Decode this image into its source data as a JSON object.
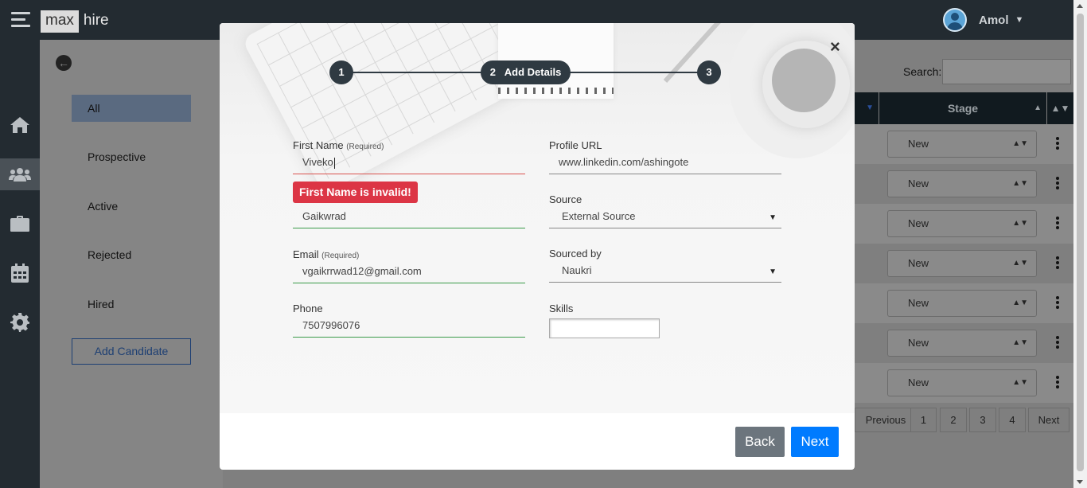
{
  "topbar": {
    "logo_left": "max",
    "logo_right": "hire",
    "username": "Amol"
  },
  "rail": [
    "home-icon",
    "users-icon",
    "briefcase-icon",
    "calendar-icon",
    "gear-icon"
  ],
  "filters": {
    "items": [
      "All",
      "Prospective",
      "Active",
      "Rejected",
      "Hired"
    ],
    "add_candidate": "Add Candidate"
  },
  "table": {
    "search_label": "Search:",
    "stage_header": "Stage",
    "stage_values": [
      "New",
      "New",
      "New",
      "New",
      "New",
      "New",
      "New"
    ],
    "pagination": [
      "Previous",
      "1",
      "2",
      "3",
      "4",
      "Next"
    ]
  },
  "modal": {
    "close": "×",
    "steps": [
      {
        "number": "1",
        "label": ""
      },
      {
        "number": "2",
        "label": "Add Details"
      },
      {
        "number": "3",
        "label": ""
      }
    ],
    "left_fields": {
      "first_name": {
        "label": "First Name",
        "required": "(Required)",
        "value": "Viveko"
      },
      "last_name": {
        "value": "Gaikwrad"
      },
      "email": {
        "label": "Email",
        "required": "(Required)",
        "value": "vgaikrrwad12@gmail.com"
      },
      "phone": {
        "label": "Phone",
        "value": "7507996076"
      }
    },
    "error": "First Name is invalid!",
    "right_fields": {
      "profile_url": {
        "label": "Profile URL",
        "value": "www.linkedin.com/ashingote"
      },
      "source": {
        "label": "Source",
        "value": "External Source"
      },
      "sourced_by": {
        "label": "Sourced by",
        "value": "Naukri"
      },
      "skills": {
        "label": "Skills",
        "value": ""
      }
    },
    "buttons": {
      "back": "Back",
      "next": "Next"
    }
  }
}
